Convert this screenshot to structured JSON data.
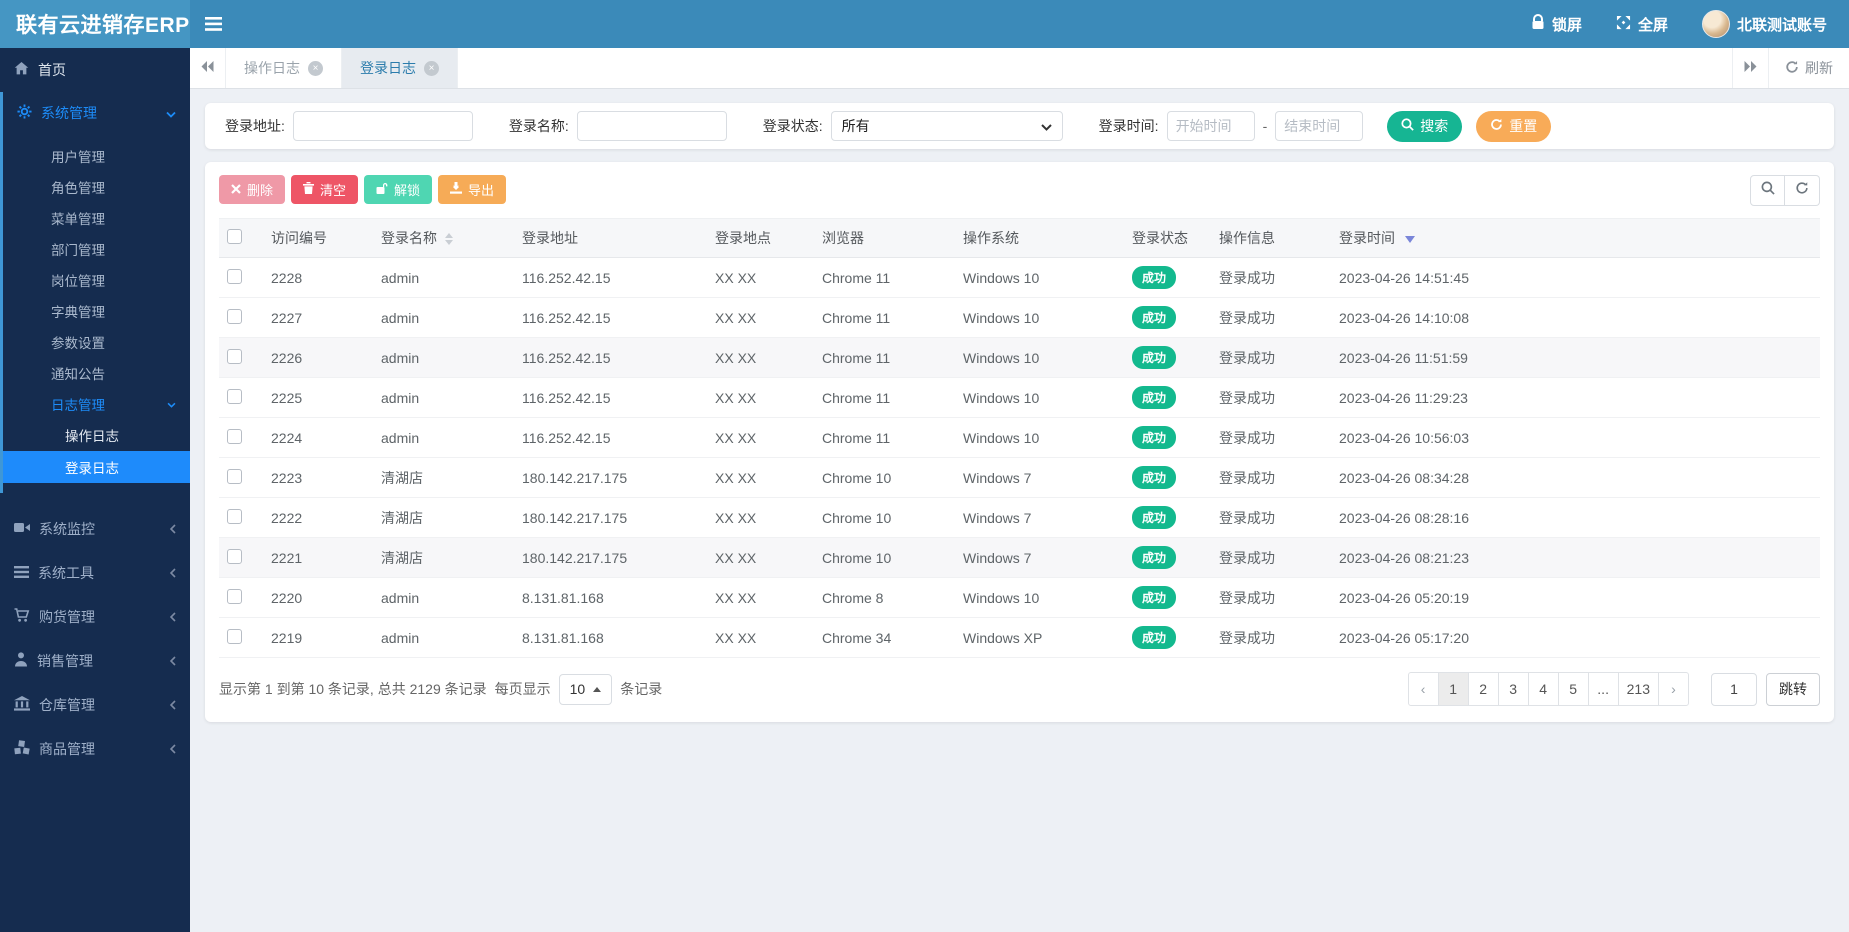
{
  "app": {
    "title": "联有云进销存ERP"
  },
  "header": {
    "lock_label": "锁屏",
    "fullscreen_label": "全屏",
    "username": "北联测试账号"
  },
  "tabbar": {
    "tabs": [
      {
        "label": "操作日志",
        "active": false
      },
      {
        "label": "登录日志",
        "active": true
      }
    ],
    "refresh_label": "刷新"
  },
  "sidebar": {
    "home": "首页",
    "system": {
      "label": "系统管理",
      "children": [
        "用户管理",
        "角色管理",
        "菜单管理",
        "部门管理",
        "岗位管理",
        "字典管理",
        "参数设置",
        "通知公告"
      ]
    },
    "log": {
      "label": "日志管理",
      "children": [
        "操作日志",
        "登录日志"
      ],
      "active_child": "登录日志"
    },
    "others": [
      "系统监控",
      "系统工具",
      "购货管理",
      "销售管理",
      "仓库管理",
      "商品管理"
    ]
  },
  "filters": {
    "address_label": "登录地址:",
    "name_label": "登录名称:",
    "status_label": "登录状态:",
    "status_value": "所有",
    "time_label": "登录时间:",
    "start_placeholder": "开始时间",
    "dash": "-",
    "end_placeholder": "结束时间",
    "search_label": "搜索",
    "reset_label": "重置"
  },
  "toolbar": {
    "delete_label": "删除",
    "clear_label": "清空",
    "unlock_label": "解锁",
    "export_label": "导出"
  },
  "table": {
    "headers": [
      "访问编号",
      "登录名称",
      "登录地址",
      "登录地点",
      "浏览器",
      "操作系统",
      "登录状态",
      "操作信息",
      "登录时间"
    ],
    "rows": [
      {
        "id": "2228",
        "name": "admin",
        "address": "116.252.42.15",
        "location": "XX XX",
        "browser": "Chrome 11",
        "os": "Windows 10",
        "status": "成功",
        "message": "登录成功",
        "time": "2023-04-26 14:51:45"
      },
      {
        "id": "2227",
        "name": "admin",
        "address": "116.252.42.15",
        "location": "XX XX",
        "browser": "Chrome 11",
        "os": "Windows 10",
        "status": "成功",
        "message": "登录成功",
        "time": "2023-04-26 14:10:08"
      },
      {
        "id": "2226",
        "name": "admin",
        "address": "116.252.42.15",
        "location": "XX XX",
        "browser": "Chrome 11",
        "os": "Windows 10",
        "status": "成功",
        "message": "登录成功",
        "time": "2023-04-26 11:51:59"
      },
      {
        "id": "2225",
        "name": "admin",
        "address": "116.252.42.15",
        "location": "XX XX",
        "browser": "Chrome 11",
        "os": "Windows 10",
        "status": "成功",
        "message": "登录成功",
        "time": "2023-04-26 11:29:23"
      },
      {
        "id": "2224",
        "name": "admin",
        "address": "116.252.42.15",
        "location": "XX XX",
        "browser": "Chrome 11",
        "os": "Windows 10",
        "status": "成功",
        "message": "登录成功",
        "time": "2023-04-26 10:56:03"
      },
      {
        "id": "2223",
        "name": "清湖店",
        "address": "180.142.217.175",
        "location": "XX XX",
        "browser": "Chrome 10",
        "os": "Windows 7",
        "status": "成功",
        "message": "登录成功",
        "time": "2023-04-26 08:34:28"
      },
      {
        "id": "2222",
        "name": "清湖店",
        "address": "180.142.217.175",
        "location": "XX XX",
        "browser": "Chrome 10",
        "os": "Windows 7",
        "status": "成功",
        "message": "登录成功",
        "time": "2023-04-26 08:28:16"
      },
      {
        "id": "2221",
        "name": "清湖店",
        "address": "180.142.217.175",
        "location": "XX XX",
        "browser": "Chrome 10",
        "os": "Windows 7",
        "status": "成功",
        "message": "登录成功",
        "time": "2023-04-26 08:21:23"
      },
      {
        "id": "2220",
        "name": "admin",
        "address": "8.131.81.168",
        "location": "XX XX",
        "browser": "Chrome 8",
        "os": "Windows 10",
        "status": "成功",
        "message": "登录成功",
        "time": "2023-04-26 05:20:19"
      },
      {
        "id": "2219",
        "name": "admin",
        "address": "8.131.81.168",
        "location": "XX XX",
        "browser": "Chrome 34",
        "os": "Windows XP",
        "status": "成功",
        "message": "登录成功",
        "time": "2023-04-26 05:17:20"
      }
    ]
  },
  "pagination": {
    "summary": "显示第 1 到第 10 条记录, 总共 2129 条记录",
    "per_page_label": "每页显示",
    "page_size": "10",
    "unit_label": "条记录",
    "pages": [
      "‹",
      "1",
      "2",
      "3",
      "4",
      "5",
      "...",
      "213",
      "›"
    ],
    "active_page": "1",
    "jump_value": "1",
    "jump_label": "跳转"
  },
  "colors": {
    "header_blue": "#3b8ab9",
    "sidebar_navy": "#152c4f",
    "active_blue": "#1e8bfb",
    "success_badge": "#13b98e",
    "danger": "#ee5566",
    "warning": "#f6ab57",
    "teal": "#4fd6b2",
    "search_green": "#16b593"
  }
}
